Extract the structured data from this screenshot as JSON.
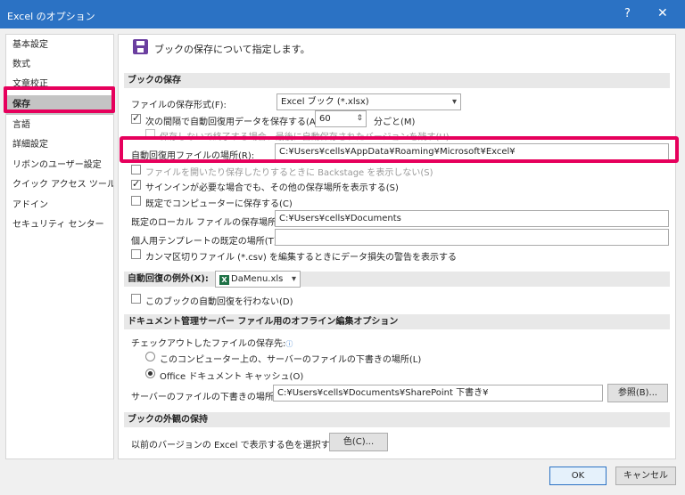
{
  "window": {
    "title": "Excel のオプション",
    "help": "?",
    "close": "✕"
  },
  "sidebar": {
    "items": [
      {
        "label": "基本設定"
      },
      {
        "label": "数式"
      },
      {
        "label": "文章校正"
      },
      {
        "label": "保存"
      },
      {
        "label": "言語"
      },
      {
        "label": "詳細設定"
      },
      {
        "label": "リボンのユーザー設定"
      },
      {
        "label": "クイック アクセス ツール バー"
      },
      {
        "label": "アドイン"
      },
      {
        "label": "セキュリティ センター"
      }
    ],
    "active": "保存"
  },
  "header": {
    "text": "ブックの保存について指定します。"
  },
  "save_workbooks": {
    "section": "ブックの保存",
    "format_label": "ファイルの保存形式(F):",
    "format_value": "Excel ブック (*.xlsx)",
    "autorecover_label": "次の間隔で自動回復用データを保存する(A):",
    "autorecover_minutes": "60",
    "minutes_label": "分ごと(M)",
    "keep_last_label": "保存しないで終了する場合、最後に自動保存されたバージョンを残す(U)",
    "autorecover_location_label": "自動回復用ファイルの場所(R):",
    "autorecover_location_value": "C:¥Users¥cells¥AppData¥Roaming¥Microsoft¥Excel¥",
    "backstage_label": "ファイルを開いたり保存したりするときに Backstage を表示しない(S)",
    "show_locations_label": "サインインが必要な場合でも、その他の保存場所を表示する(S)",
    "save_to_computer_label": "既定でコンピューターに保存する(C)",
    "default_local_label": "既定のローカル ファイルの保存場所(I):",
    "default_local_value": "C:¥Users¥cells¥Documents",
    "personal_templates_label": "個人用テンプレートの既定の場所(T):",
    "personal_templates_value": "",
    "csv_warning_label": "カンマ区切りファイル (*.csv) を編集するときにデータ損失の警告を表示する"
  },
  "autorecover_exceptions": {
    "section": "自動回復の例外(X):",
    "workbook": "DaMenu.xls",
    "disable_label": "このブックの自動回復を行わない(D)"
  },
  "offline_editing": {
    "section": "ドキュメント管理サーバー ファイル用のオフライン編集オプション",
    "checkout_label": "チェックアウトしたファイルの保存先:",
    "radio_computer": "このコンピューター上の、サーバーのファイルの下書きの場所(L)",
    "radio_cache": "Office ドキュメント キャッシュ(O)",
    "drafts_label": "サーバーのファイルの下書きの場所(V):",
    "drafts_value": "C:¥Users¥cells¥Documents¥SharePoint 下書き¥",
    "browse_label": "参照(B)..."
  },
  "visual_appearance": {
    "section": "ブックの外観の保持",
    "colors_label": "以前のバージョンの Excel で表示する色を選択する:",
    "colors_button": "色(C)..."
  },
  "footer": {
    "ok": "OK",
    "cancel": "キャンセル"
  },
  "icons": {
    "info": "ⓘ",
    "excel": "X"
  }
}
